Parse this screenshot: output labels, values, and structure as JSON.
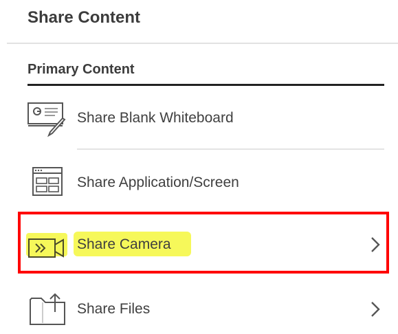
{
  "panel": {
    "title": "Share Content"
  },
  "section": {
    "label": "Primary Content"
  },
  "items": [
    {
      "label": "Share Blank Whiteboard",
      "icon": "whiteboard-icon",
      "has_chevron": false
    },
    {
      "label": "Share Application/Screen",
      "icon": "application-screen-icon",
      "has_chevron": false
    },
    {
      "label": "Share Camera",
      "icon": "camera-icon",
      "has_chevron": true,
      "highlighted": true
    },
    {
      "label": "Share Files",
      "icon": "files-folder-icon",
      "has_chevron": true
    }
  ],
  "colors": {
    "highlight_box": "#ff0000",
    "text_highlight": "#f6f85a",
    "text": "#3f3f3f",
    "icon_stroke": "#555555"
  }
}
